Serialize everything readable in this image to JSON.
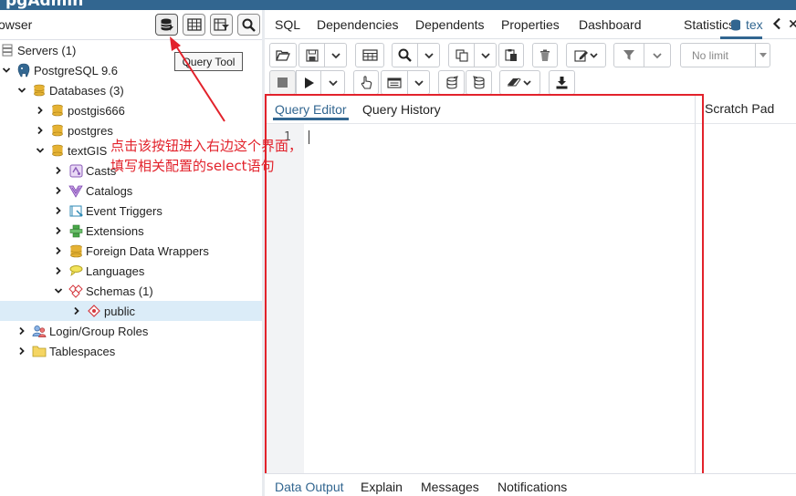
{
  "app": {
    "brand": "pgAdmin"
  },
  "browser": {
    "title": "owser",
    "toolbar": [
      {
        "name": "query-tool-button",
        "icon": "database-lightning-icon"
      },
      {
        "name": "view-data-button",
        "icon": "table-grid-icon"
      },
      {
        "name": "filtered-rows-button",
        "icon": "table-filter-icon"
      },
      {
        "name": "search-objects-button",
        "icon": "search-icon"
      }
    ],
    "tooltip": "Query Tool",
    "tree": {
      "servers": "Servers (1)",
      "server": "PostgreSQL 9.6",
      "databases": "Databases (3)",
      "db1": "postgis666",
      "db2": "postgres",
      "db3": "textGIS",
      "casts": "Casts",
      "catalogs": "Catalogs",
      "event_triggers": "Event Triggers",
      "extensions": "Extensions",
      "fdw": "Foreign Data Wrappers",
      "languages": "Languages",
      "schemas": "Schemas (1)",
      "public": "public",
      "login_roles": "Login/Group Roles",
      "tablespaces": "Tablespaces"
    }
  },
  "main_tabs": {
    "sql": "SQL",
    "dependencies": "Dependencies",
    "dependents": "Dependents",
    "properties": "Properties",
    "dashboard": "Dashboard",
    "statistics": "Statistics",
    "query_tab": "tex"
  },
  "toolbar": {
    "limit_value": "No limit"
  },
  "editor": {
    "tab_query_editor": "Query Editor",
    "tab_query_history": "Query History",
    "scratch_pad": "Scratch Pad",
    "line_number": "1"
  },
  "bottom_tabs": {
    "data_output": "Data Output",
    "explain": "Explain",
    "messages": "Messages",
    "notifications": "Notifications"
  },
  "annotation": {
    "line1": "点击该按钮进入右边这个界面，",
    "line2": "填写相关配置的select语句",
    "color": "#e2222b"
  },
  "colors": {
    "accent": "#326690",
    "selection": "#dbecf8",
    "annotation": "#e2222b"
  }
}
